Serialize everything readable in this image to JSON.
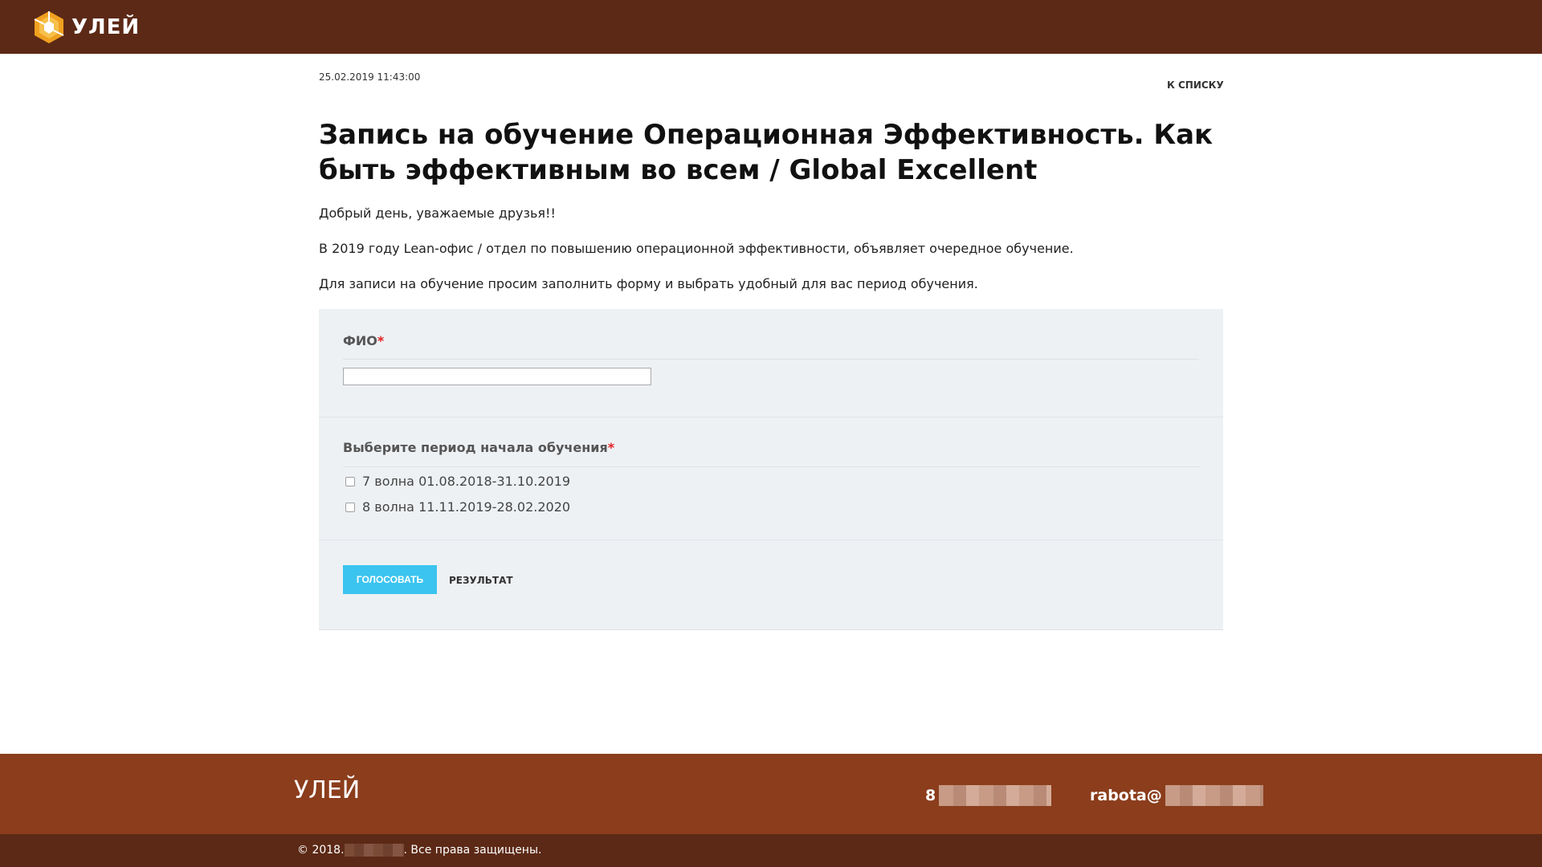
{
  "header": {
    "brand": "УЛЕЙ"
  },
  "post": {
    "date": "25.02.2019 11:43:00",
    "back_link": "К СПИСКУ",
    "title": "Запись на обучение Операционная Эффективность. Как быть эффективным во всем / Global Excellent",
    "paragraphs": [
      "Добрый день, уважаемые друзья!!",
      "В 2019 году Lean-офис / отдел по повышению операционной эффективности, объявляет очередное обучение.",
      "Для записи на обучение просим заполнить форму и выбрать удобный для вас период обучения."
    ]
  },
  "form": {
    "fio_label": "ФИО",
    "fio_value": "",
    "period_label": "Выберите период начала обучения",
    "required_mark": "*",
    "options": [
      {
        "label": "7 волна 01.08.2018-31.10.2019",
        "checked": false
      },
      {
        "label": "8 волна 11.11.2019-28.02.2020",
        "checked": false
      }
    ],
    "vote_button": "ГОЛОСОВАТЬ",
    "result_link": "РЕЗУЛЬТАТ"
  },
  "footer": {
    "brand": "УЛЕЙ",
    "phone_prefix": "8",
    "email_prefix": "rabota@",
    "copyright_prefix": "© 2018.",
    "copyright_suffix": ". Все права защищены."
  },
  "colors": {
    "header_bg": "#5c2916",
    "footer_bg": "#8b3d1c",
    "form_bg": "#eef1f4",
    "button_bg": "#3bc4ef",
    "required": "#e02020"
  }
}
